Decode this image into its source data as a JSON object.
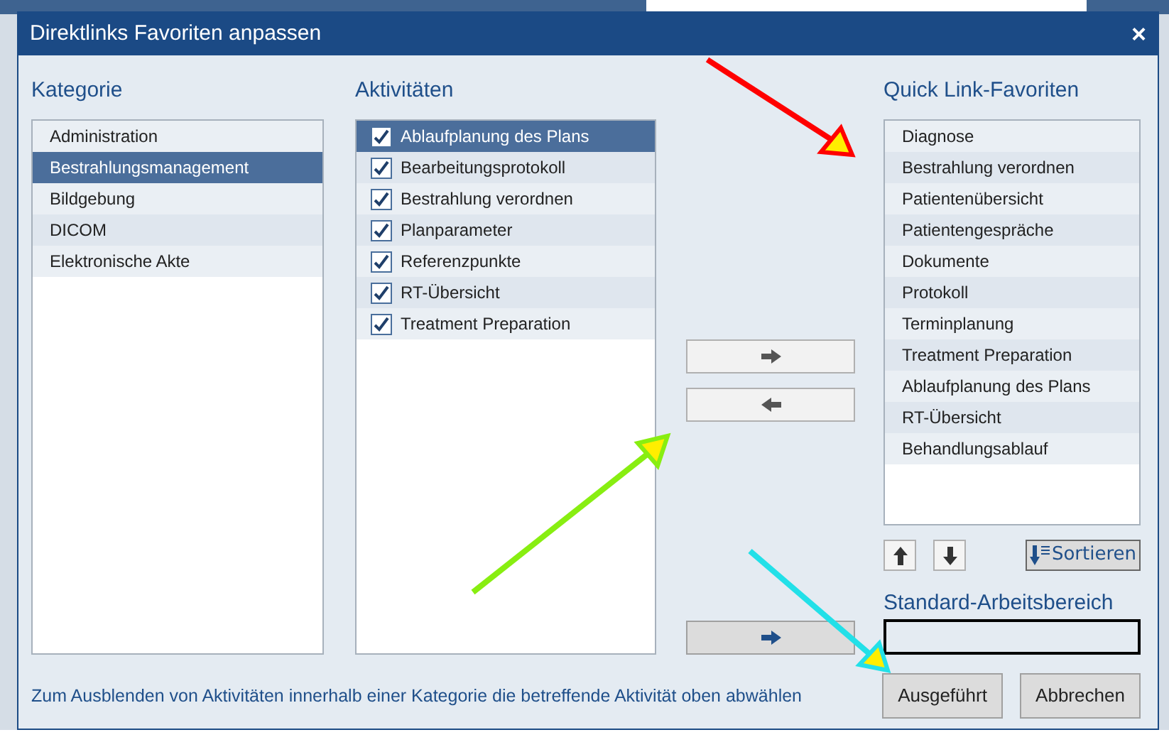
{
  "window": {
    "title": "Direktlinks Favoriten anpassen",
    "close": "×"
  },
  "kategorie": {
    "heading": "Kategorie",
    "items": [
      {
        "label": "Administration",
        "selected": false
      },
      {
        "label": "Bestrahlungsmanagement",
        "selected": true
      },
      {
        "label": "Bildgebung",
        "selected": false
      },
      {
        "label": "DICOM",
        "selected": false
      },
      {
        "label": "Elektronische Akte",
        "selected": false
      }
    ]
  },
  "aktivitaeten": {
    "heading": "Aktivitäten",
    "items": [
      {
        "label": "Ablaufplanung des Plans",
        "checked": true,
        "selected": true
      },
      {
        "label": "Bearbeitungsprotokoll",
        "checked": true,
        "selected": false
      },
      {
        "label": "Bestrahlung verordnen",
        "checked": true,
        "selected": false
      },
      {
        "label": "Planparameter",
        "checked": true,
        "selected": false
      },
      {
        "label": "Referenzpunkte",
        "checked": true,
        "selected": false
      },
      {
        "label": "RT-Übersicht",
        "checked": true,
        "selected": false
      },
      {
        "label": "Treatment Preparation",
        "checked": true,
        "selected": false
      }
    ]
  },
  "quick_links": {
    "heading": "Quick Link-Favoriten",
    "items": [
      {
        "label": "Diagnose",
        "selected": false
      },
      {
        "label": "Bestrahlung verordnen",
        "selected": false
      },
      {
        "label": "Patientenübersicht",
        "selected": false
      },
      {
        "label": "Patientengespräche",
        "selected": false
      },
      {
        "label": "Dokumente",
        "selected": false
      },
      {
        "label": "Protokoll",
        "selected": false
      },
      {
        "label": "Terminplanung",
        "selected": false
      },
      {
        "label": "Treatment Preparation",
        "selected": false
      },
      {
        "label": "Ablaufplanung des Plans",
        "selected": false
      },
      {
        "label": "RT-Übersicht",
        "selected": false
      },
      {
        "label": "Behandlungsablauf",
        "selected": false
      }
    ]
  },
  "sort_button": "Sortieren",
  "standard": {
    "heading": "Standard-Arbeitsbereich"
  },
  "hint": "Zum Ausblenden von Aktivitäten innerhalb einer Kategorie die betreffende Aktivität oben abwählen",
  "buttons": [
    "Ausgeführt",
    "Abbrechen"
  ]
}
